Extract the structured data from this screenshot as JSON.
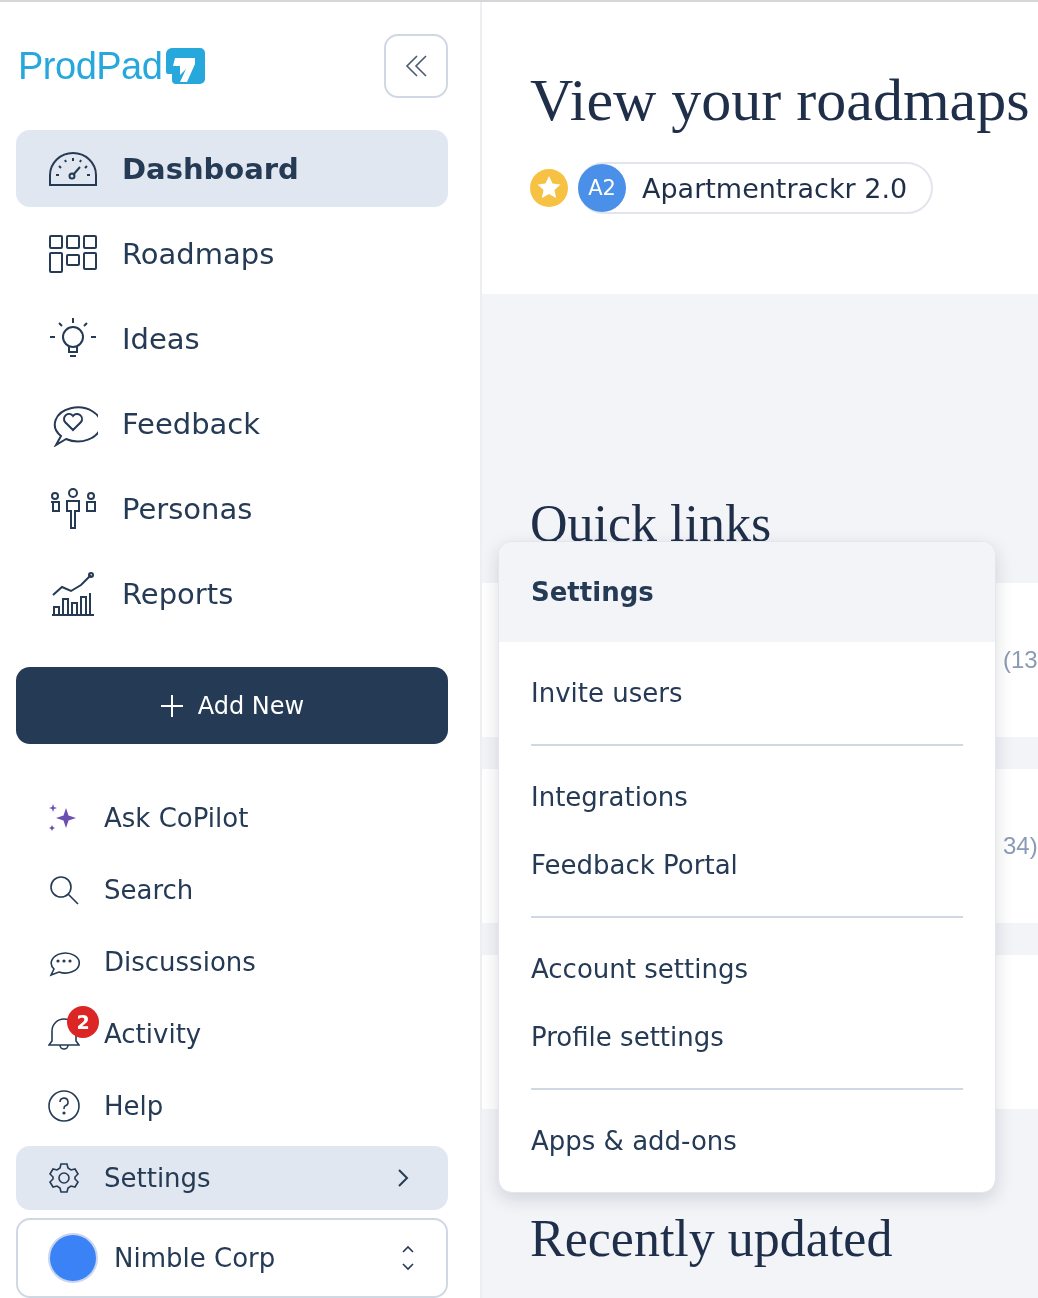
{
  "brand": "ProdPad",
  "nav": [
    {
      "label": "Dashboard",
      "selected": true
    },
    {
      "label": "Roadmaps",
      "selected": false
    },
    {
      "label": "Ideas",
      "selected": false
    },
    {
      "label": "Feedback",
      "selected": false
    },
    {
      "label": "Personas",
      "selected": false
    },
    {
      "label": "Reports",
      "selected": false
    }
  ],
  "add_button": {
    "label": "Add New"
  },
  "secondary_nav": [
    {
      "label": "Ask CoPilot",
      "selected": false
    },
    {
      "label": "Search",
      "selected": false
    },
    {
      "label": "Discussions",
      "selected": false
    },
    {
      "label": "Activity",
      "selected": false,
      "badge": "2"
    },
    {
      "label": "Help",
      "selected": false
    },
    {
      "label": "Settings",
      "selected": true
    }
  ],
  "workspace": {
    "name": "Nimble Corp"
  },
  "page_title": "View your roadmaps",
  "product": {
    "initials": "A2",
    "name": "Apartmentrackr 2.0",
    "favorite": true
  },
  "sections": [
    {
      "title": "Quick links"
    },
    {
      "title": "Recently updated"
    }
  ],
  "quick_link_counts": [
    "(13",
    "34)"
  ],
  "settings_menu": {
    "title": "Settings",
    "groups": [
      [
        "Invite users"
      ],
      [
        "Integrations",
        "Feedback Portal"
      ],
      [
        "Account settings",
        "Profile settings"
      ],
      [
        "Apps & add-ons"
      ]
    ]
  }
}
